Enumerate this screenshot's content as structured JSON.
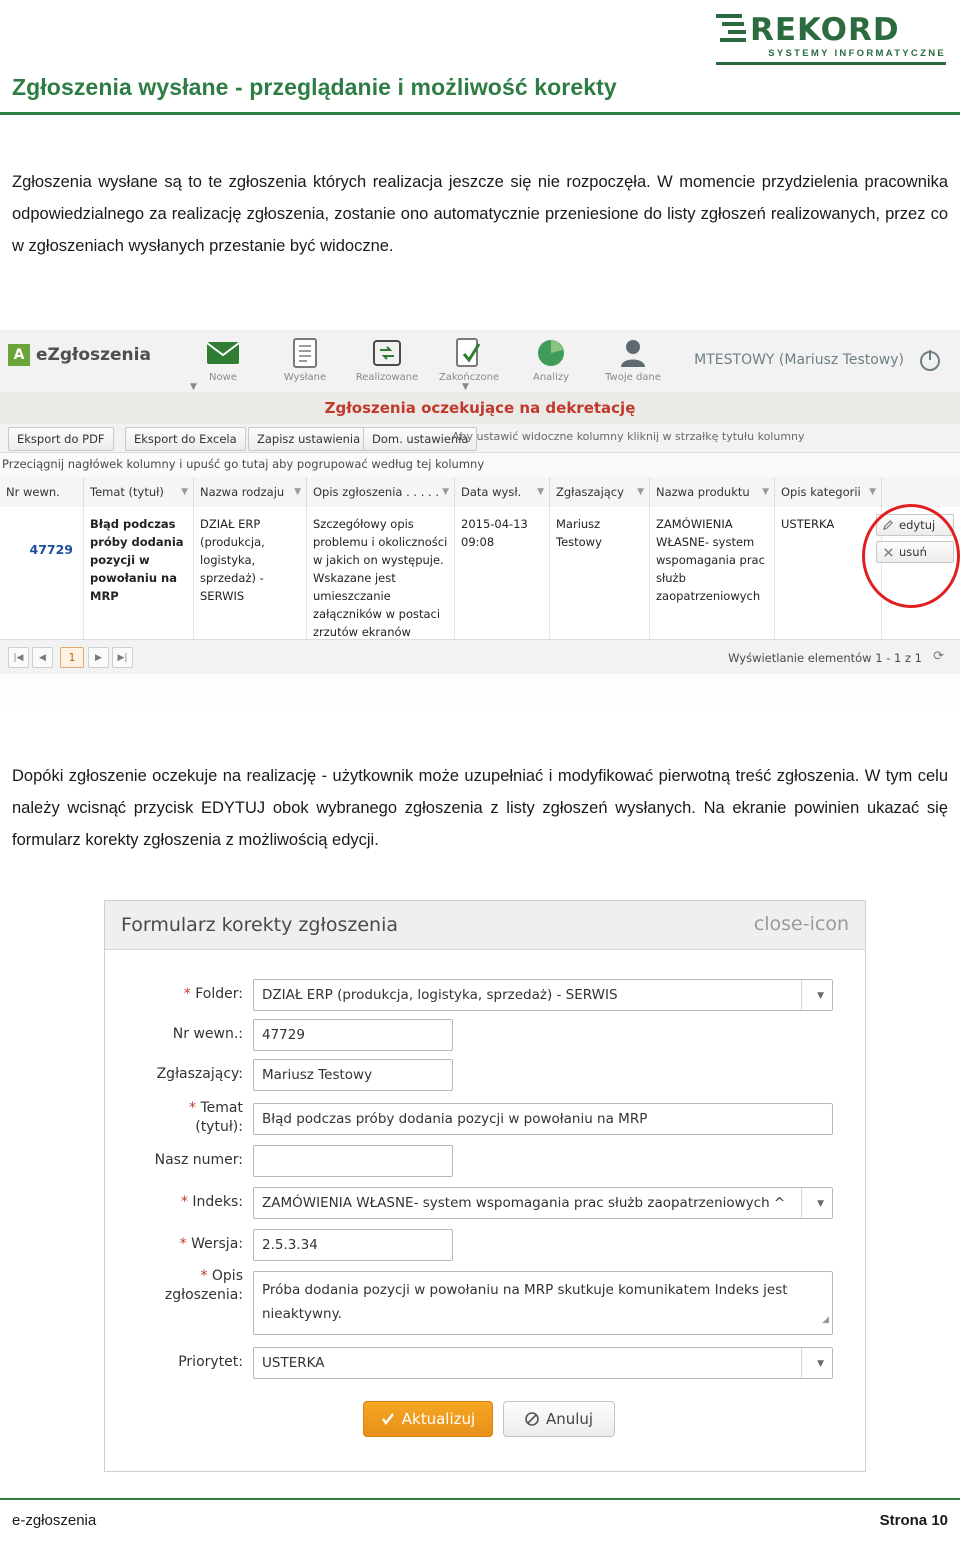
{
  "logo": {
    "brand": "REKORD",
    "tagline": "SYSTEMY INFORMATYCZNE"
  },
  "doc": {
    "title": "Zgłoszenia wysłane - przeglądanie i możliwość korekty",
    "paragraph1": "Zgłoszenia wysłane są to te zgłoszenia których realizacja jeszcze się nie rozpoczęła. W momencie przydzielenia pracownika odpowiedzialnego za realizację zgłoszenia, zostanie ono automatycznie przeniesione do listy zgłoszeń realizowanych, przez co w zgłoszeniach wysłanych przestanie być widoczne.",
    "paragraph2": "Dopóki zgłoszenie oczekuje na realizację - użytkownik może uzupełniać i modyfikować pierwotną treść zgłoszenia. W tym celu należy wcisnąć przycisk EDYTUJ obok wybranego zgłoszenia z listy zgłoszeń wysłanych. Na ekranie powinien ukazać się formularz korekty zgłoszenia z możliwością edycji."
  },
  "footer": {
    "left": "e-zgłoszenia",
    "right": "Strona 10"
  },
  "app": {
    "brand": "eZgłoszenia",
    "brand_mark": "A",
    "nav": [
      {
        "label": "Nowe",
        "icon": "envelope-icon"
      },
      {
        "label": "Wysłane",
        "icon": "document-icon"
      },
      {
        "label": "Realizowane",
        "icon": "refresh-icon"
      },
      {
        "label": "Zakończone",
        "icon": "check-document-icon"
      },
      {
        "label": "Analizy",
        "icon": "pie-chart-icon"
      },
      {
        "label": "Twoje dane",
        "icon": "user-icon"
      }
    ],
    "user": "MTESTOWY (Mariusz Testowy)",
    "power_icon": "power-icon",
    "band_title": "Zgłoszenia oczekujące na dekretację",
    "toolbar": {
      "export_pdf": "Eksport do PDF",
      "export_excel": "Eksport do Excela",
      "save_settings": "Zapisz ustawienia",
      "default_settings": "Dom. ustawienia",
      "hint": "Aby ustawić widoczne kolumny kliknij w strzałkę tytułu kolumny"
    },
    "drag_hint": "Przeciągnij nagłówek kolumny i upuść go tutaj aby pogrupować według tej kolumny",
    "columns": [
      "Nr wewn.",
      "Temat (tytuł)",
      "Nazwa rodzaju",
      "Opis zgłoszenia . . . . .",
      "Data wysł.",
      "Zgłaszający",
      "Nazwa produktu",
      "Opis kategorii"
    ],
    "row": {
      "nr": "47729",
      "temat": "Błąd podczas próby dodania pozycji w powołaniu na MRP",
      "rodzaj": "DZIAŁ ERP (produkcja, logistyka, sprzedaż) - SERWIS",
      "opis": "Szczegółowy opis problemu i okoliczności w jakich on występuje. Wskazane jest umieszczanie załączników w postaci zrzutów ekranów ilustrujących błąd.",
      "data": "2015-04-13 09:08",
      "zglaszajacy": "Mariusz Testowy",
      "produkt": "ZAMÓWIENIA WŁASNE- system wspomagania prac służb zaopatrzeniowych",
      "kategoria": "USTERKA"
    },
    "actions": {
      "edit": "edytuj",
      "delete": "usuń",
      "edit_icon": "pencil-icon",
      "delete_icon": "close-icon"
    },
    "paging": {
      "first": "|◀",
      "prev": "◀",
      "current": "1",
      "next": "▶",
      "last": "▶|",
      "info": "Wyświetlanie elementów 1 - 1 z 1",
      "refresh_icon": "refresh-icon"
    }
  },
  "form": {
    "title": "Formularz korekty zgłoszenia",
    "close_icon": "close-icon",
    "fields": [
      {
        "label": "* Folder:",
        "required": true,
        "value": "DZIAŁ ERP (produkcja, logistyka, sprzedaż) - SERWIS",
        "type": "select"
      },
      {
        "label": "Nr wewn.:",
        "required": false,
        "value": "47729",
        "type": "text"
      },
      {
        "label": "Zgłaszający:",
        "required": false,
        "value": "Mariusz Testowy",
        "type": "text"
      },
      {
        "label": "* Temat (tytuł):",
        "required": true,
        "value": "Błąd podczas próby dodania pozycji w powołaniu na MRP",
        "type": "text"
      },
      {
        "label": "Nasz numer:",
        "required": false,
        "value": "",
        "type": "text"
      },
      {
        "label": "* Indeks:",
        "required": true,
        "value": "ZAMÓWIENIA WŁASNE- system wspomagania prac służb zaopatrzeniowych ^",
        "type": "select"
      },
      {
        "label": "* Wersja:",
        "required": true,
        "value": "2.5.3.34",
        "type": "text"
      },
      {
        "label": "* Opis zgłoszenia:",
        "required": true,
        "value": "Próba dodania pozycji w powołaniu na MRP skutkuje komunikatem Indeks jest nieaktywny.",
        "type": "textarea"
      },
      {
        "label": "Priorytet:",
        "required": false,
        "value": "USTERKA",
        "type": "select"
      }
    ],
    "buttons": {
      "submit": "Aktualizuj",
      "submit_icon": "check-icon",
      "cancel": "Anuluj",
      "cancel_icon": "cancel-icon"
    }
  },
  "colors": {
    "brand_green": "#2e7d45",
    "accent_red": "#c0392b",
    "orange": "#f5a623"
  }
}
